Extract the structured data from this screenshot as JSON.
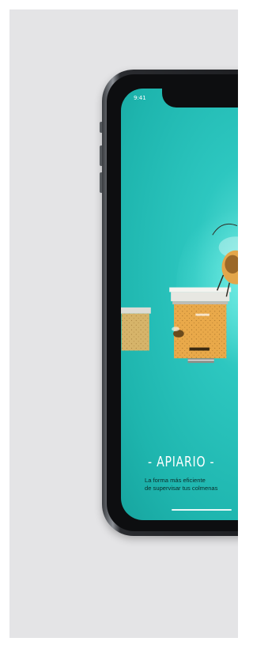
{
  "status_bar": {
    "time": "9:41"
  },
  "app": {
    "title": "- APIARIO -",
    "tagline_line1": "La forma más eficiente",
    "tagline_line2": "de supervisar tus colmenas"
  },
  "colors": {
    "background": "#e4e4e6",
    "screen_teal": "#1eb5ae",
    "hive_body": "#e9a94a",
    "hive_roof": "#f2f2ee",
    "phone_frame": "#1a1b1e"
  }
}
